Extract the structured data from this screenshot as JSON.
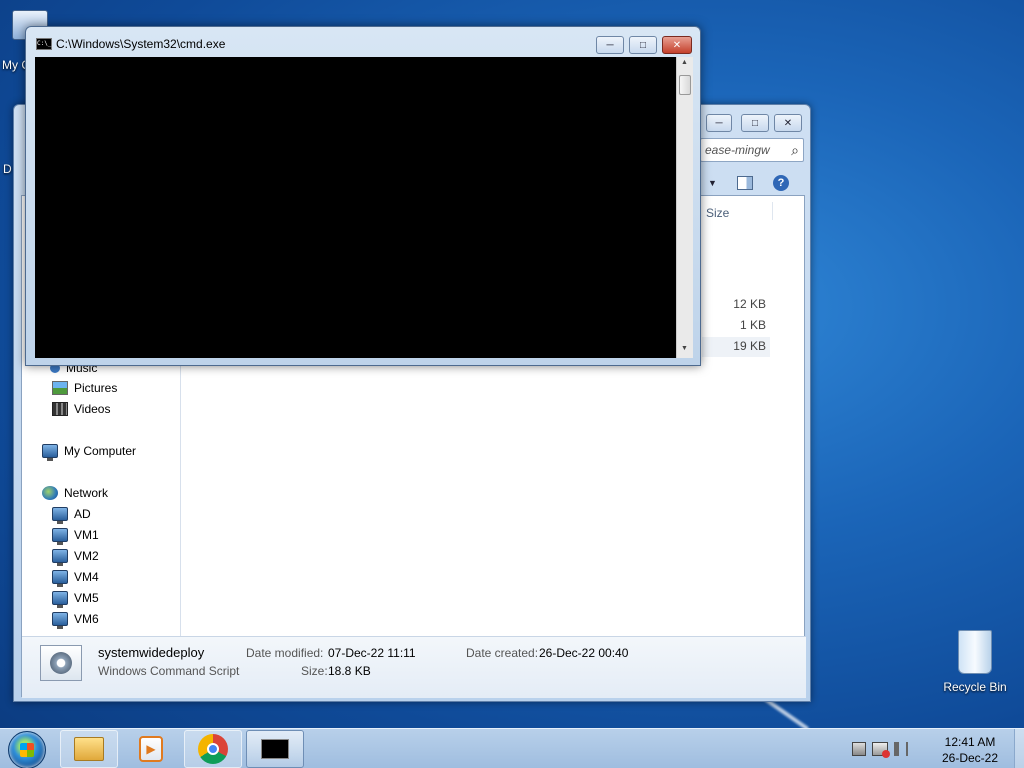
{
  "desktop": {
    "icons": [
      {
        "label": "My C",
        "icon": "my-computer-icon"
      },
      {
        "label": "D",
        "icon": "desktop-icon"
      },
      {
        "label": "Recycle Bin",
        "icon": "recycle-bin-icon"
      }
    ]
  },
  "cmd_window": {
    "title": "C:\\Windows\\System32\\cmd.exe",
    "icon_text": "C:\\_",
    "minimize": "─",
    "maximize": "□",
    "close": "✕",
    "scroll_up": "▲",
    "scroll_down": "▼"
  },
  "explorer": {
    "minimize": "─",
    "maximize": "□",
    "close": "✕",
    "search_placeholder": "ease-mingw",
    "search_icon": "⌕",
    "help_icon": "?",
    "dropdown_icon": "▼",
    "column_size": "Size",
    "file_sizes": [
      "12 KB",
      "1 KB",
      "19 KB"
    ],
    "nav": {
      "music": "Music",
      "pictures": "Pictures",
      "videos": "Videos",
      "my_computer": "My Computer",
      "network": "Network",
      "network_items": [
        "AD",
        "VM1",
        "VM2",
        "VM4",
        "VM5",
        "VM6"
      ]
    },
    "details": {
      "name": "systemwidedeploy",
      "type": "Windows Command Script",
      "date_modified_label": "Date modified:",
      "date_modified": "07-Dec-22 11:11",
      "date_created_label": "Date created:",
      "date_created": "26-Dec-22 00:40",
      "size_label": "Size:",
      "size": "18.8 KB"
    }
  },
  "taskbar": {
    "items": [
      "start-button",
      "file-explorer",
      "media-player",
      "chrome",
      "command-prompt"
    ],
    "clock_time": "12:41 AM",
    "clock_date": "26-Dec-22"
  },
  "colors": {
    "desktop": "#1b65b8",
    "console": "#000000",
    "window_frame": "#bed3ea"
  }
}
